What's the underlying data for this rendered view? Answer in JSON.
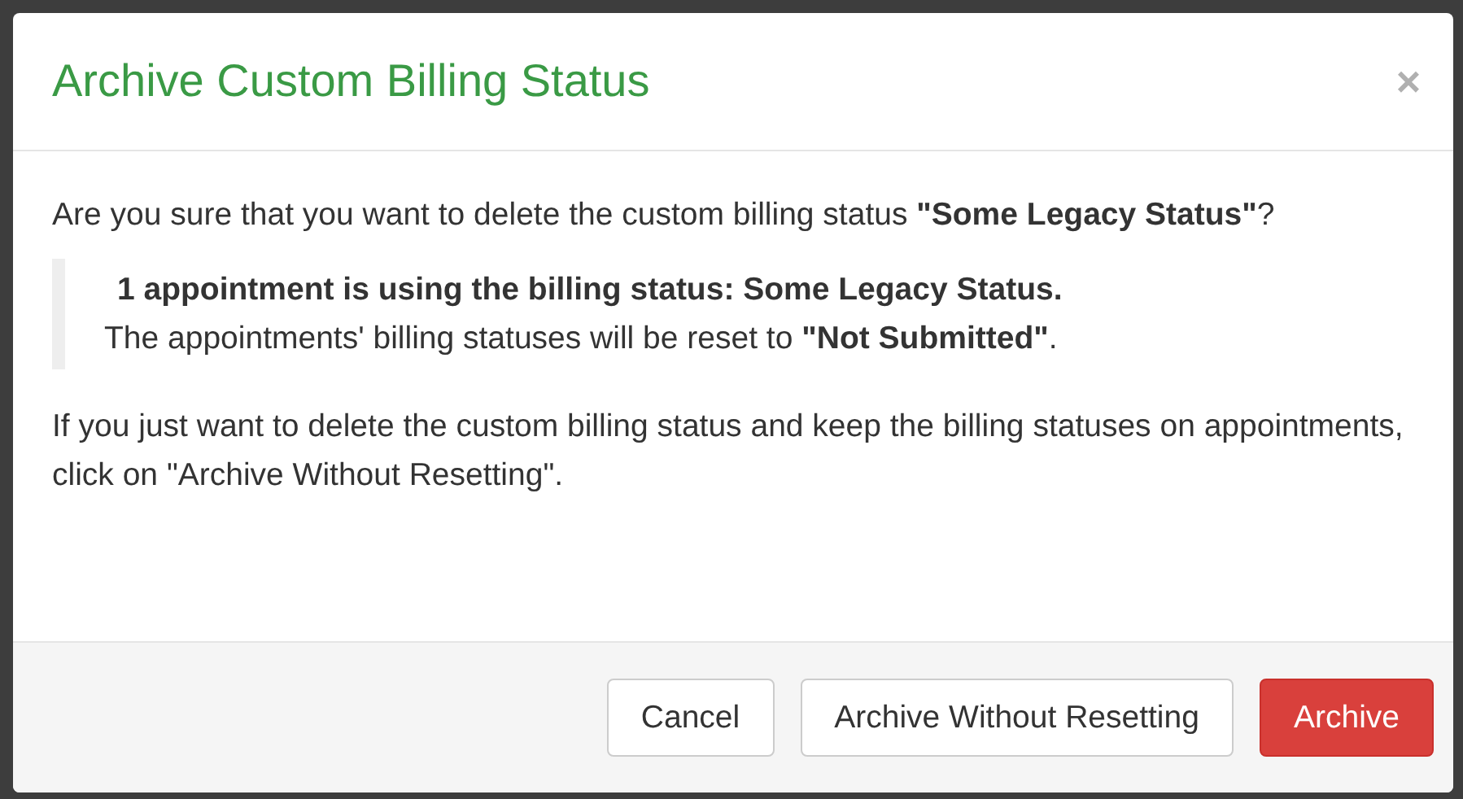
{
  "dialog": {
    "title": "Archive Custom Billing Status",
    "close": "×"
  },
  "body": {
    "question": "Are you sure that you want to delete the custom billing status **\"Some Legacy Status\"**?",
    "notice": {
      "heading": "1 appointment is using the billing status: Some Legacy Status.",
      "detail": "The appointments' billing statuses will be reset to **\"Not Submitted\"**."
    },
    "hint": "If you just want to delete the custom billing status and keep the billing statuses on appointments, click on \"Archive Without Resetting\"."
  },
  "buttons": [
    {
      "label": "Cancel",
      "kind": "default"
    },
    {
      "label": "Archive Without Resetting",
      "kind": "default"
    },
    {
      "label": "Archive",
      "kind": "danger"
    }
  ]
}
